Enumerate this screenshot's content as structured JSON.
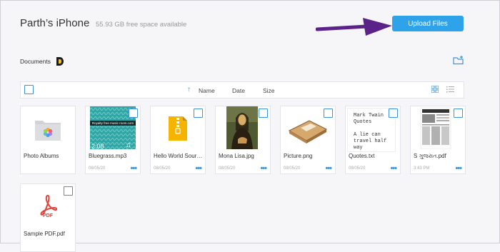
{
  "header": {
    "title": "Parth’s iPhone",
    "free_space": "55.93 GB free space available",
    "upload_label": "Upload Files"
  },
  "breadcrumb": {
    "label": "Documents"
  },
  "toolbar": {
    "sort_name": "Name",
    "sort_date": "Date",
    "sort_size": "Size"
  },
  "files": [
    {
      "name": "Photo Albums",
      "date": ""
    },
    {
      "name": "Bluegrass.mp3",
      "date": "08/05/20",
      "duration": "2:08",
      "thumb_text": "Royalty free music room.com"
    },
    {
      "name": "Hello World Sour…",
      "date": "08/05/20"
    },
    {
      "name": "Mona Lisa.jpg",
      "date": "08/05/20"
    },
    {
      "name": "Picture.png",
      "date": "08/05/20"
    },
    {
      "name": "Quotes.txt",
      "date": "08/05/20",
      "preview": "Mark Twain Quotes\n\nA lie can travel half way"
    },
    {
      "name": "S ગુજરાત.pdf",
      "date": "3:43 PM"
    },
    {
      "name": "Sample PDF.pdf",
      "date": "",
      "badge": "PDF"
    }
  ],
  "colors": {
    "accent": "#2ea3ea",
    "arrow": "#5b2389"
  }
}
